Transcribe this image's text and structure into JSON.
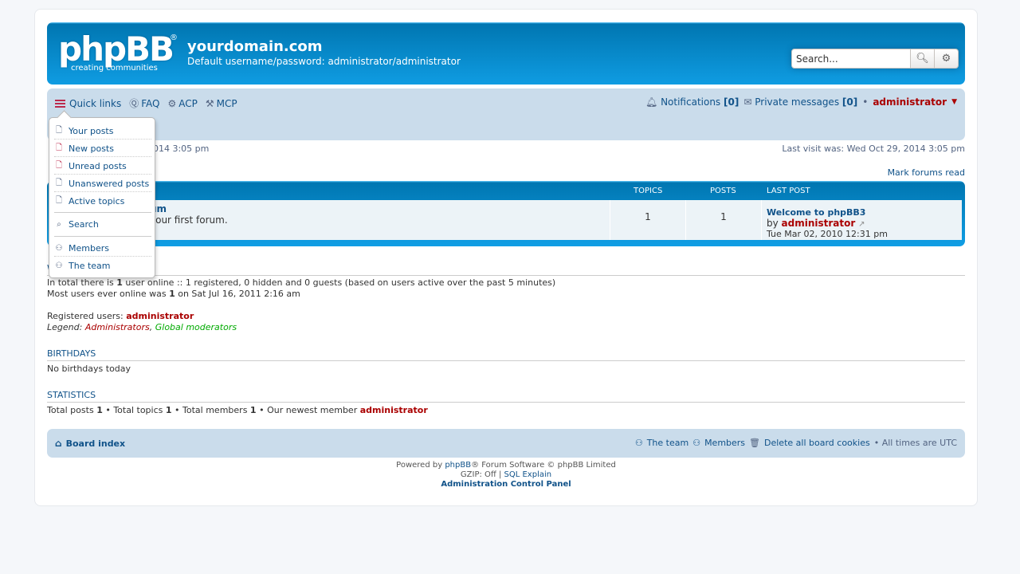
{
  "header": {
    "logo_text": "phpBB",
    "logo_tagline": "creating communities",
    "site_title": "yourdomain.com",
    "site_desc": "Default username/password: administrator/administrator",
    "search_placeholder": "Search..."
  },
  "navbar": {
    "quick_links": "Quick links",
    "faq": "FAQ",
    "acp": "ACP",
    "mcp": "MCP",
    "notifications": "Notifications",
    "notifications_count": "[0]",
    "private_messages": "Private messages",
    "pm_count": "[0]",
    "username": "administrator"
  },
  "visit": {
    "current_fragment": "29, 2014 3:05 pm",
    "last_visit": "Last visit was: Wed Oct 29, 2014 3:05 pm",
    "mark_read": "Mark forums read"
  },
  "forum_table": {
    "col_topics": "Topics",
    "col_posts": "Posts",
    "col_last_post": "Last post",
    "row": {
      "title_fragment": "um",
      "desc_fragment": "your first forum.",
      "topics": "1",
      "posts": "1",
      "last_post_title": "Welcome to phpBB3",
      "last_post_by": "by",
      "last_post_user": "administrator",
      "last_post_date": "Tue Mar 02, 2010 12:31 pm"
    }
  },
  "online": {
    "header_fragment": "W",
    "line1_pre": "In total there is",
    "line1_num": "1",
    "line1_post": "user online :: 1 registered, 0 hidden and 0 guests (based on users active over the past 5 minutes)",
    "line2_pre": "Most users ever online was",
    "line2_num": "1",
    "line2_post": "on Sat Jul 16, 2011 2:16 am",
    "registered_label": "Registered users:",
    "registered_user": "administrator",
    "legend_label": "Legend:",
    "legend_admins": "Administrators",
    "legend_sep": ",",
    "legend_gmods": "Global moderators"
  },
  "birthdays": {
    "header": "Birthdays",
    "text": "No birthdays today"
  },
  "statistics": {
    "header": "Statistics",
    "total_posts_label": "Total posts",
    "total_posts": "1",
    "total_topics_label": "• Total topics",
    "total_topics": "1",
    "total_members_label": "• Total members",
    "total_members": "1",
    "newest_label": "• Our newest member",
    "newest_user": "administrator"
  },
  "footer": {
    "board_index": "Board index",
    "the_team": "The team",
    "members": "Members",
    "delete_cookies": "Delete all board cookies",
    "times": "• All times are UTC",
    "powered_by": "Powered by",
    "phpbb_link": "phpBB",
    "powered_rest": "® Forum Software © phpBB Limited",
    "gzip": "GZIP: Off |",
    "sql_explain": "SQL Explain",
    "acp": "Administration Control Panel"
  },
  "dropdown": {
    "items": [
      "Your posts",
      "New posts",
      "Unread posts",
      "Unanswered posts",
      "Active topics",
      "Search",
      "Members",
      "The team"
    ]
  }
}
